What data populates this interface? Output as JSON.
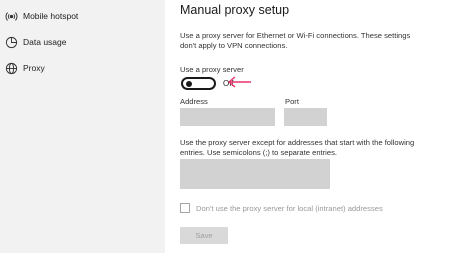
{
  "sidebar": {
    "items": [
      {
        "label": "Mobile hotspot",
        "icon": "hotspot-icon"
      },
      {
        "label": "Data usage",
        "icon": "data-usage-icon"
      },
      {
        "label": "Proxy",
        "icon": "globe-icon"
      }
    ]
  },
  "main": {
    "title": "Manual proxy setup",
    "description": "Use a proxy server for Ethernet or Wi-Fi connections. These settings don't apply to VPN connections.",
    "use_proxy_label": "Use a proxy server",
    "toggle_state": "Off",
    "address_label": "Address",
    "port_label": "Port",
    "exceptions_description": "Use the proxy server except for addresses that start with the following entries. Use semicolons (;) to separate entries.",
    "local_checkbox_label": "Don't use the proxy server for local (intranet) addresses",
    "save_label": "Save",
    "annotation_color": "#e8336b"
  }
}
